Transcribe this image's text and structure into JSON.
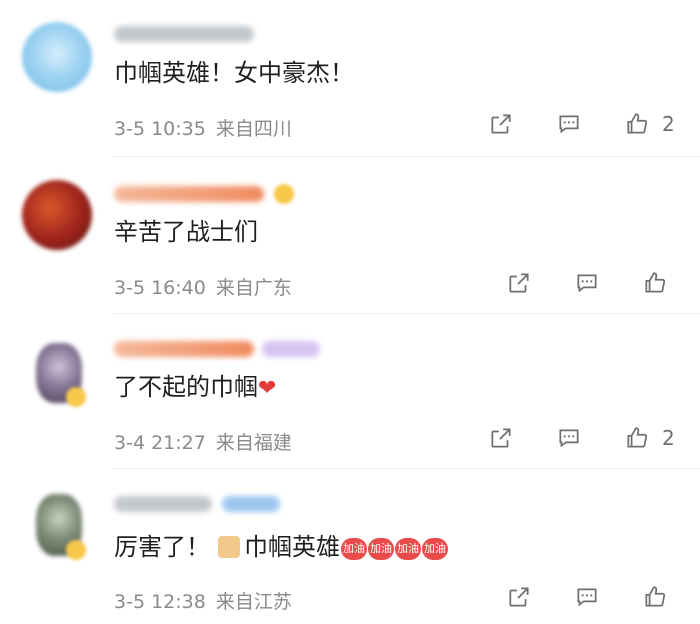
{
  "comments": [
    {
      "text": "巾帼英雄！女中豪杰！",
      "date": "3-5 10:35",
      "location": "来自四川",
      "like_count": "2"
    },
    {
      "text": "辛苦了战士们",
      "date": "3-5 16:40",
      "location": "来自广东",
      "like_count": ""
    },
    {
      "text": "了不起的巾帼",
      "date": "3-4 21:27",
      "location": "来自福建",
      "like_count": "2"
    },
    {
      "text_a": "厉害了！",
      "text_b": "巾帼英雄",
      "date": "3-5 12:38",
      "location": "来自江苏",
      "like_count": ""
    }
  ],
  "icons": {
    "share": "share-icon",
    "reply": "comment-icon",
    "like": "thumbs-up-icon",
    "heart": "heart-icon",
    "thumb_emoji": "thumbs-up-emoji-icon",
    "cheer_sticker": "jiayou-sticker-icon"
  },
  "stickers": {
    "cheer_label": "加油"
  },
  "colors": {
    "text": "#1f1f1f",
    "meta": "#8a8a8a",
    "icon": "#6f6f6f",
    "heart": "#e33a3a"
  }
}
